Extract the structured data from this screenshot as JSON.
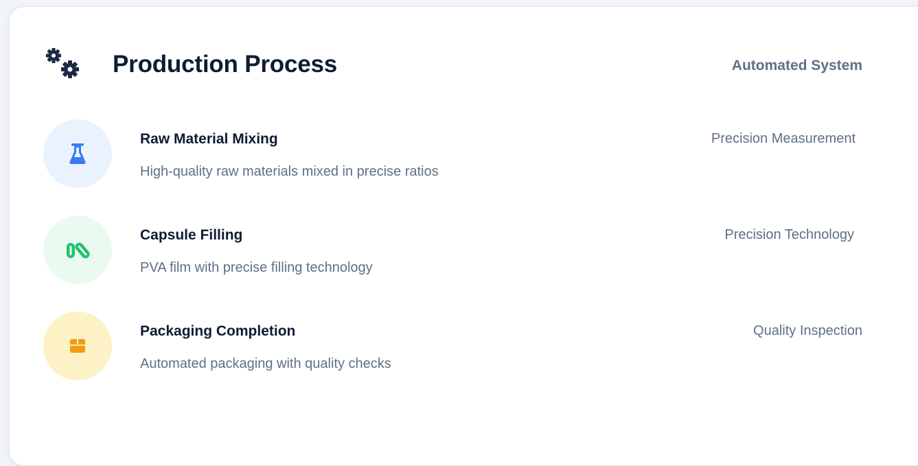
{
  "header": {
    "icon": "gears-icon",
    "title": "Production Process",
    "tag": "Automated System"
  },
  "steps": [
    {
      "icon": "flask-icon",
      "title": "Raw Material Mixing",
      "description": "High-quality raw materials mixed in precise ratios",
      "tag": "Precision Measurement",
      "circle_color": "#eaf2fe",
      "icon_color": "#3b7bf2"
    },
    {
      "icon": "capsules-icon",
      "title": "Capsule Filling",
      "description": "PVA film with precise filling technology",
      "tag": "Precision Technology",
      "circle_color": "#ebfaf1",
      "icon_color": "#1fc26b"
    },
    {
      "icon": "box-icon",
      "title": "Packaging Completion",
      "description": "Automated packaging with quality checks",
      "tag": "Quality Inspection",
      "circle_color": "#fdf1c6",
      "icon_color": "#f39c12"
    }
  ],
  "colors": {
    "title": "#0f1b33",
    "muted": "#5f6f86",
    "header_icon": "#1c2a44"
  }
}
